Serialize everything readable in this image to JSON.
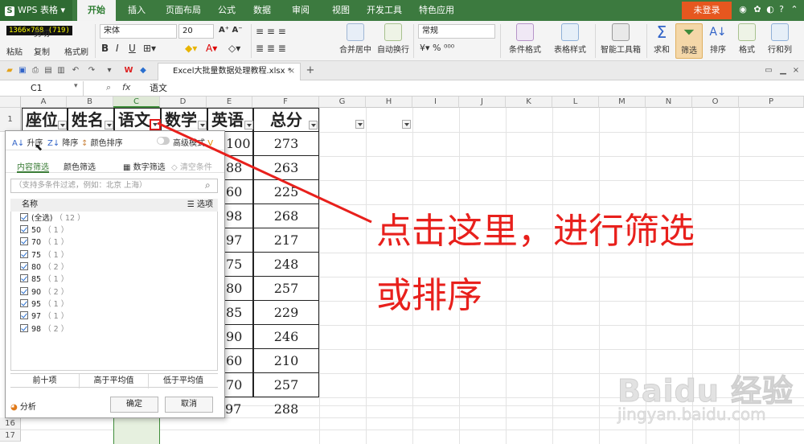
{
  "app": {
    "name": "WPS 表格",
    "login": "未登录"
  },
  "menu_tabs": [
    "开始",
    "插入",
    "页面布局",
    "公式",
    "数据",
    "审阅",
    "视图",
    "开发工具",
    "特色应用"
  ],
  "coord_overlay": "1366×768 (719)",
  "ribbon": {
    "clipboard": {
      "paste": "粘贴",
      "cut": "剪切",
      "copy": "复制",
      "format_painter": "格式刷"
    },
    "font_name": "宋体",
    "font_size": "20",
    "align": {
      "merge_center": "合并居中",
      "wrap": "自动换行"
    },
    "number_format": "常规",
    "styles": {
      "cond_format": "条件格式",
      "table_style": "表格样式"
    },
    "smart_toolbox": "智能工具箱",
    "sum": "求和",
    "filter": "筛选",
    "sort": "排序",
    "format": "格式",
    "row_col": "行和列"
  },
  "document_tab": "Excel大批量数据处理教程.xlsx *",
  "formula_bar": {
    "cell_ref": "C1",
    "fx": "fx",
    "content": "语文"
  },
  "columns": [
    "A",
    "B",
    "C",
    "D",
    "E",
    "F",
    "G",
    "H",
    "I",
    "J",
    "K",
    "L",
    "M",
    "N",
    "O",
    "P"
  ],
  "rows_visible": [
    "1",
    "16",
    "17"
  ],
  "headers": [
    "座位",
    "姓名",
    "语文",
    "数学",
    "英语",
    "总分"
  ],
  "english_scores": [
    "100",
    "88",
    "60",
    "98",
    "97",
    "75",
    "80",
    "85",
    "90",
    "60",
    "70",
    "97"
  ],
  "totals": [
    "273",
    "263",
    "225",
    "268",
    "217",
    "248",
    "257",
    "229",
    "246",
    "210",
    "257",
    "288"
  ],
  "filter_popup": {
    "sort_asc": "升序",
    "sort_desc": "降序",
    "sort_color": "颜色排序",
    "advanced": "高级模式",
    "tab_content": "内容筛选",
    "tab_color": "颜色筛选",
    "number_filter": "数字筛选",
    "clear": "清空条件",
    "search_placeholder": "（支持多条件过滤，例如：北京 上海）",
    "list_name": "名称",
    "options": "选项",
    "items": [
      {
        "label": "(全选)",
        "count": "（ 12 ）"
      },
      {
        "label": "50",
        "count": "（ 1 ）"
      },
      {
        "label": "70",
        "count": "（ 1 ）"
      },
      {
        "label": "75",
        "count": "（ 1 ）"
      },
      {
        "label": "80",
        "count": "（ 2 ）"
      },
      {
        "label": "85",
        "count": "（ 1 ）"
      },
      {
        "label": "90",
        "count": "（ 2 ）"
      },
      {
        "label": "95",
        "count": "（ 1 ）"
      },
      {
        "label": "97",
        "count": "（ 1 ）"
      },
      {
        "label": "98",
        "count": "（ 2 ）"
      }
    ],
    "top10": "前十项",
    "above_avg": "高于平均值",
    "below_avg": "低于平均值",
    "analyze": "分析",
    "ok": "确定",
    "cancel": "取消"
  },
  "annotation": {
    "line1": "点击这里，进行筛选",
    "line2": "或排序",
    "color": "#e8201c"
  },
  "watermark": {
    "brand": "Baidu 经验",
    "url": "jingyan.baidu.com"
  }
}
